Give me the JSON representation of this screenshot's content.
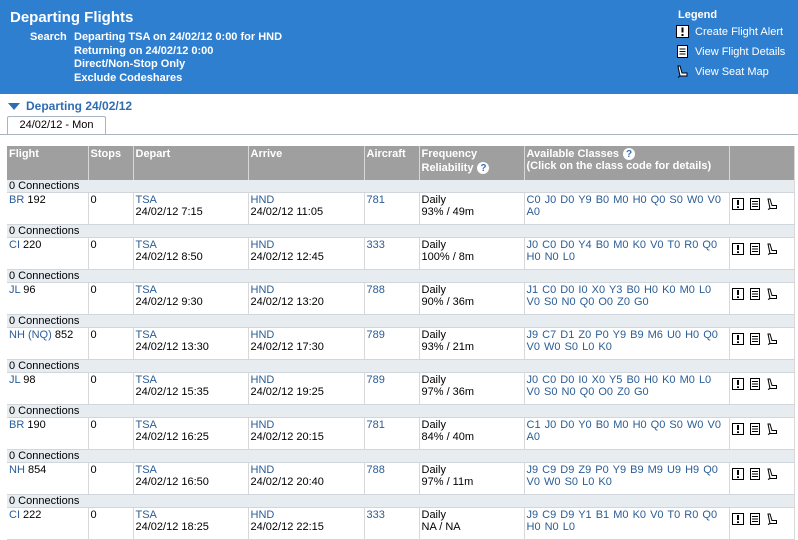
{
  "header": {
    "title": "Departing Flights",
    "search_label": "Search",
    "search_lines": [
      "Departing TSA on 24/02/12 0:00 for HND",
      "Returning on 24/02/12 0:00",
      "Direct/Non-Stop Only",
      "Exclude Codeshares"
    ]
  },
  "legend": {
    "title": "Legend",
    "items": [
      {
        "icon": "alert-icon",
        "label": "Create Flight Alert"
      },
      {
        "icon": "details-icon",
        "label": "View Flight Details"
      },
      {
        "icon": "seat-icon",
        "label": "View Seat Map"
      }
    ]
  },
  "section": {
    "title": "Departing 24/02/12",
    "tab": "24/02/12 - Mon"
  },
  "columns": [
    "Flight",
    "Stops",
    "Depart",
    "Arrive",
    "Aircraft",
    "Frequency",
    "Reliability",
    "Available Classes",
    "(Click on the class code for details)"
  ],
  "flights": [
    {
      "conn": "0 Connections",
      "flight_link": "BR",
      "flight_rest": " 192",
      "stops": "0",
      "dep_code": "TSA",
      "dep_time": "24/02/12 7:15",
      "arr_code": "HND",
      "arr_time": "24/02/12 11:05",
      "aircraft": "781",
      "freq": "Daily",
      "rel": "93% / 49m",
      "classes": "C0 J0 D0 Y9 B0 M0 H0 Q0 S0 W0 V0 A0"
    },
    {
      "conn": "0 Connections",
      "flight_link": "CI",
      "flight_rest": " 220",
      "stops": "0",
      "dep_code": "TSA",
      "dep_time": "24/02/12 8:50",
      "arr_code": "HND",
      "arr_time": "24/02/12 12:45",
      "aircraft": "333",
      "freq": "Daily",
      "rel": "100% / 8m",
      "classes": "J0 C0 D0 Y4 B0 M0 K0 V0 T0 R0 Q0 H0 N0 L0"
    },
    {
      "conn": "0 Connections",
      "flight_link": "JL",
      "flight_rest": " 96",
      "stops": "0",
      "dep_code": "TSA",
      "dep_time": "24/02/12 9:30",
      "arr_code": "HND",
      "arr_time": "24/02/12 13:20",
      "aircraft": "788",
      "freq": "Daily",
      "rel": "90% / 36m",
      "classes": "J1 C0 D0 I0 X0 Y3 B0 H0 K0 M0 L0 V0 S0 N0 Q0 O0 Z0 G0"
    },
    {
      "conn": "0 Connections",
      "flight_link": "NH (NQ)",
      "flight_rest": " 852",
      "stops": "0",
      "dep_code": "TSA",
      "dep_time": "24/02/12 13:30",
      "arr_code": "HND",
      "arr_time": "24/02/12 17:30",
      "aircraft": "789",
      "freq": "Daily",
      "rel": "93% / 21m",
      "classes": "J9 C7 D1 Z0 P0 Y9 B9 M6 U0 H0 Q0 V0 W0 S0 L0 K0"
    },
    {
      "conn": "0 Connections",
      "flight_link": "JL",
      "flight_rest": " 98",
      "stops": "0",
      "dep_code": "TSA",
      "dep_time": "24/02/12 15:35",
      "arr_code": "HND",
      "arr_time": "24/02/12 19:25",
      "aircraft": "789",
      "freq": "Daily",
      "rel": "97% / 36m",
      "classes": "J0 C0 D0 I0 X0 Y5 B0 H0 K0 M0 L0 V0 S0 N0 Q0 O0 Z0 G0"
    },
    {
      "conn": "0 Connections",
      "flight_link": "BR",
      "flight_rest": " 190",
      "stops": "0",
      "dep_code": "TSA",
      "dep_time": "24/02/12 16:25",
      "arr_code": "HND",
      "arr_time": "24/02/12 20:15",
      "aircraft": "781",
      "freq": "Daily",
      "rel": "84% / 40m",
      "classes": "C1 J0 D0 Y0 B0 M0 H0 Q0 S0 W0 V0 A0"
    },
    {
      "conn": "0 Connections",
      "flight_link": "NH",
      "flight_rest": " 854",
      "stops": "0",
      "dep_code": "TSA",
      "dep_time": "24/02/12 16:50",
      "arr_code": "HND",
      "arr_time": "24/02/12 20:40",
      "aircraft": "788",
      "freq": "Daily",
      "rel": "97% / 11m",
      "classes": "J9 C9 D9 Z9 P0 Y9 B9 M9 U9 H9 Q0 V0 W0 S0 L0 K0"
    },
    {
      "conn": "0 Connections",
      "flight_link": "CI",
      "flight_rest": " 222",
      "stops": "0",
      "dep_code": "TSA",
      "dep_time": "24/02/12 18:25",
      "arr_code": "HND",
      "arr_time": "24/02/12 22:15",
      "aircraft": "333",
      "freq": "Daily",
      "rel": "NA / NA",
      "classes": "J9 C9 D9 Y1 B1 M0 K0 V0 T0 R0 Q0 H0 N0 L0"
    }
  ]
}
